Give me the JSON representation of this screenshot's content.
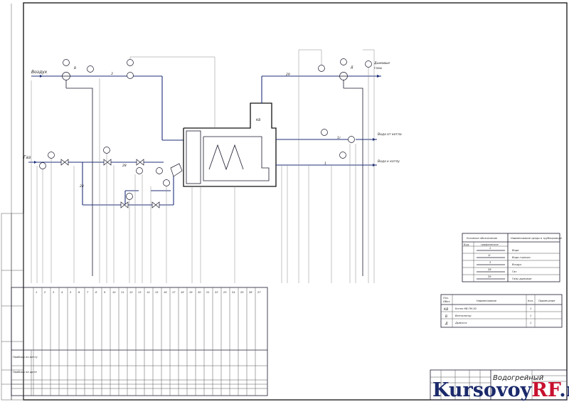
{
  "labels": {
    "air_in": "Воздух",
    "gas_in": "Газ",
    "flue_gas_out": "Дымовые газы",
    "water_from_boiler": "Вода от котла",
    "water_to_boiler": "Вода к котлу",
    "boiler_tag": "КВ",
    "fan_tag": "В",
    "exhauster_tag": "Д"
  },
  "line_codes": {
    "air": "3",
    "gas": "28",
    "flue": "29",
    "water_out": "1г",
    "water_in": "1"
  },
  "legend": {
    "header_left": "Условное обозначение",
    "header_right": "Наименование среды в трубопроводе",
    "sub_code": "Буд.",
    "sub_graphic": "графическое",
    "rows": [
      {
        "code": "1",
        "name": "Вода"
      },
      {
        "code": "1г",
        "name": "Вода горячая"
      },
      {
        "code": "3",
        "name": "Воздух"
      },
      {
        "code": "28",
        "name": "Газ"
      },
      {
        "code": "29",
        "name": "Газы дымовые"
      }
    ]
  },
  "spec_table": {
    "headers": [
      "Поз. Обоз.",
      "Наименование",
      "Кол.",
      "Примечание"
    ],
    "rows": [
      {
        "pos": "КВ",
        "name": "Котел КВ-ГМ-30",
        "qty": "1"
      },
      {
        "pos": "В",
        "name": "Вентилятор",
        "qty": "1"
      },
      {
        "pos": "Д",
        "name": "Дымосос",
        "qty": "1"
      }
    ]
  },
  "instrument_table": {
    "numbers": [
      "1",
      "2",
      "3",
      "4",
      "5",
      "6",
      "7",
      "8",
      "9",
      "10",
      "11",
      "12",
      "13",
      "14",
      "15",
      "16",
      "17",
      "18",
      "19",
      "20",
      "21",
      "22",
      "23",
      "24",
      "25",
      "26",
      "27"
    ],
    "row_labels": [
      "Приборы по месту",
      "Приборы на щите"
    ]
  },
  "title_block": {
    "title": "Водогрейный"
  },
  "watermark": {
    "left": "Kursovoy",
    "right": "RF",
    "suffix": ".ru"
  }
}
